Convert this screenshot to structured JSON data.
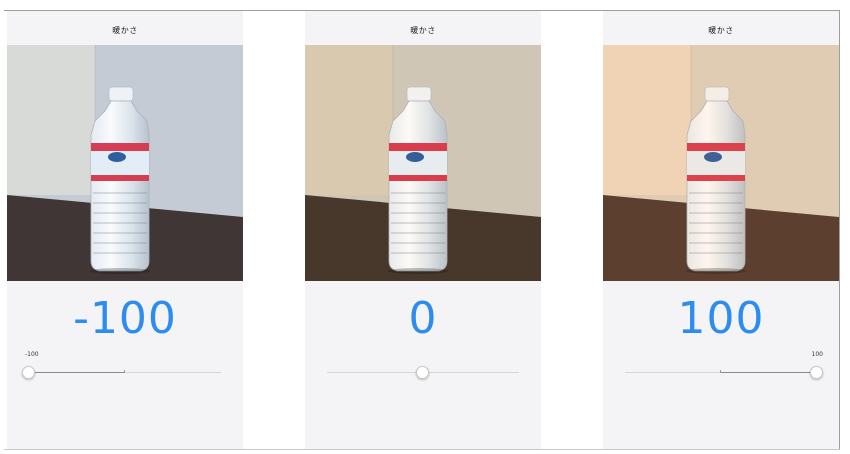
{
  "panels": [
    {
      "title": "暖かさ",
      "value": "-100",
      "level_percent": 0,
      "show_min_label": true,
      "show_max_label": false,
      "tint": "cool",
      "colors": {
        "wall_left": "#dcdcd8",
        "wall_right": "#c7ccd4",
        "table": "#3a2e2b"
      }
    },
    {
      "title": "暖かさ",
      "value": "0",
      "level_percent": 50,
      "show_min_label": false,
      "show_max_label": false,
      "tint": "neutral",
      "colors": {
        "wall_left": "#d9cbb4",
        "wall_right": "#cfc8bc",
        "table": "#3f3128"
      }
    },
    {
      "title": "暖かさ",
      "value": "100",
      "level_percent": 100,
      "show_min_label": false,
      "show_max_label": true,
      "tint": "warm",
      "colors": {
        "wall_left": "#eed9bf",
        "wall_right": "#ddd0be",
        "table": "#4a342a"
      }
    }
  ],
  "slider": {
    "min_label": "-100",
    "max_label": "100"
  },
  "accent": "#2d8cf0"
}
